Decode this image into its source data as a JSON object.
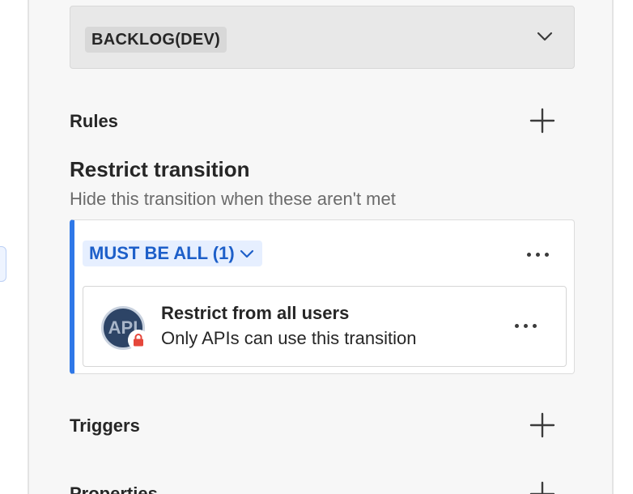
{
  "status": {
    "value": "BACKLOG(DEV)"
  },
  "rules": {
    "title": "Rules"
  },
  "restrict": {
    "title": "Restrict transition",
    "subtitle": "Hide this transition when these aren't met",
    "group": {
      "label": "MUST BE ALL (1)",
      "rule": {
        "avatar_text": "API",
        "title": "Restrict from all users",
        "description": "Only APIs can use this transition"
      }
    }
  },
  "triggers": {
    "title": "Triggers"
  },
  "properties": {
    "title": "Properties"
  },
  "colors": {
    "accent": "#2f78e8",
    "pill_text": "#1d5fc9",
    "pill_bg": "#e6efff",
    "lock": "#e5473b",
    "avatar_bg": "#2d4466"
  },
  "icons": {
    "select_chevron": "chevron-down-icon",
    "add": "plus-icon",
    "more": "more-horizontal-icon",
    "lock": "lock-icon"
  }
}
